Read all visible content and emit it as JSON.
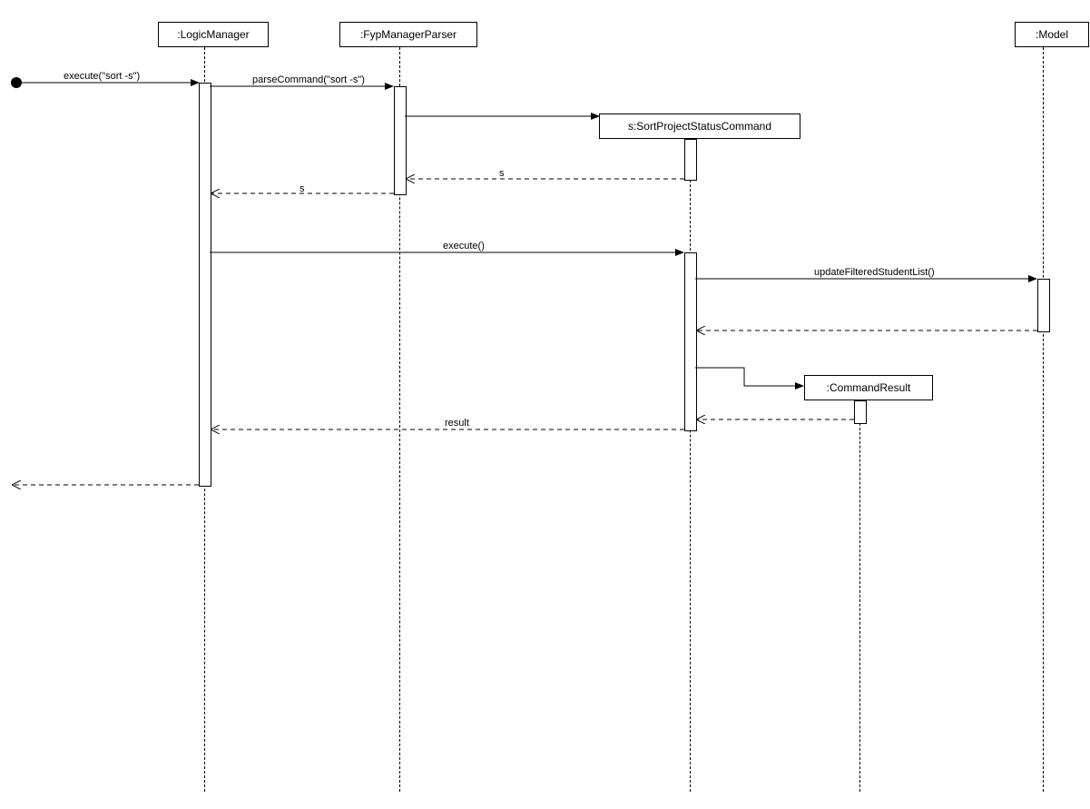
{
  "participants": {
    "logicManager": ":LogicManager",
    "fypManagerParser": ":FypManagerParser",
    "sortCommand": "s:SortProjectStatusCommand",
    "model": ":Model",
    "commandResult": ":CommandResult"
  },
  "messages": {
    "executeSort": "execute(\"sort -s\")",
    "parseCommand": "parseCommand(\"sort -s\")",
    "returnS1": "s",
    "returnS2": "s",
    "execute": "execute()",
    "updateFiltered": "updateFilteredStudentList()",
    "result": "result"
  }
}
